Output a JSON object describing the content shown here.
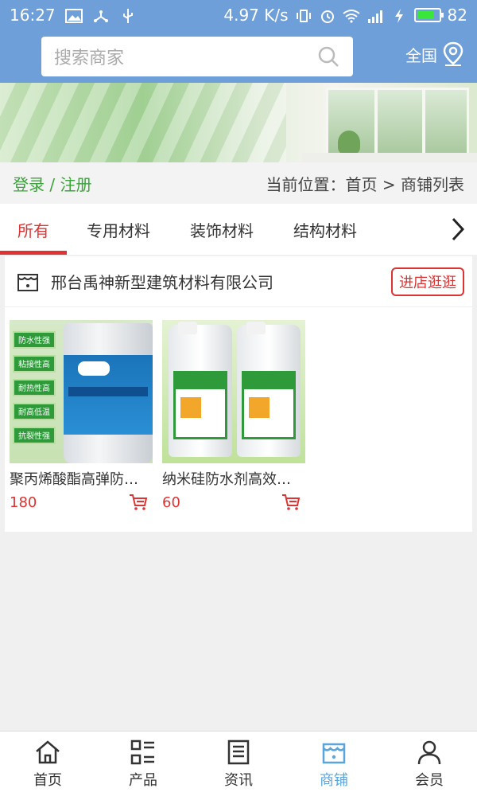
{
  "status_bar": {
    "time": "16:27",
    "speed": "4.97 K/s",
    "battery": "82",
    "battery_level": 0.82
  },
  "search": {
    "placeholder": "搜索商家"
  },
  "region": {
    "label": "全国"
  },
  "info_row": {
    "login_label": "登录 / 注册",
    "breadcrumb": "当前位置：首页 > 商铺列表"
  },
  "tabs": [
    {
      "label": "所有",
      "active": true
    },
    {
      "label": "专用材料",
      "active": false
    },
    {
      "label": "装饰材料",
      "active": false
    },
    {
      "label": "结构材料",
      "active": false
    }
  ],
  "store": {
    "name": "邢台禹神新型建筑材料有限公司",
    "visit_label": "进店逛逛",
    "products": [
      {
        "name": "聚丙烯酸酯高弹防…",
        "price": "180",
        "image_labels": [
          "防水性强",
          "粘接性高",
          "耐热性高",
          "耐高低温",
          "抗裂性强"
        ]
      },
      {
        "name": "纳米硅防水剂高效…",
        "price": "60"
      }
    ]
  },
  "bottom_nav": [
    {
      "label": "首页",
      "icon": "home-icon",
      "active": false
    },
    {
      "label": "产品",
      "icon": "grid-list-icon",
      "active": false
    },
    {
      "label": "资讯",
      "icon": "news-icon",
      "active": false
    },
    {
      "label": "商铺",
      "icon": "store-icon",
      "active": true
    },
    {
      "label": "会员",
      "icon": "user-icon",
      "active": false
    }
  ],
  "colors": {
    "header": "#6f9fd9",
    "accent_red": "#d33333",
    "login_green": "#3aa33a",
    "nav_active": "#5aa5dc"
  }
}
